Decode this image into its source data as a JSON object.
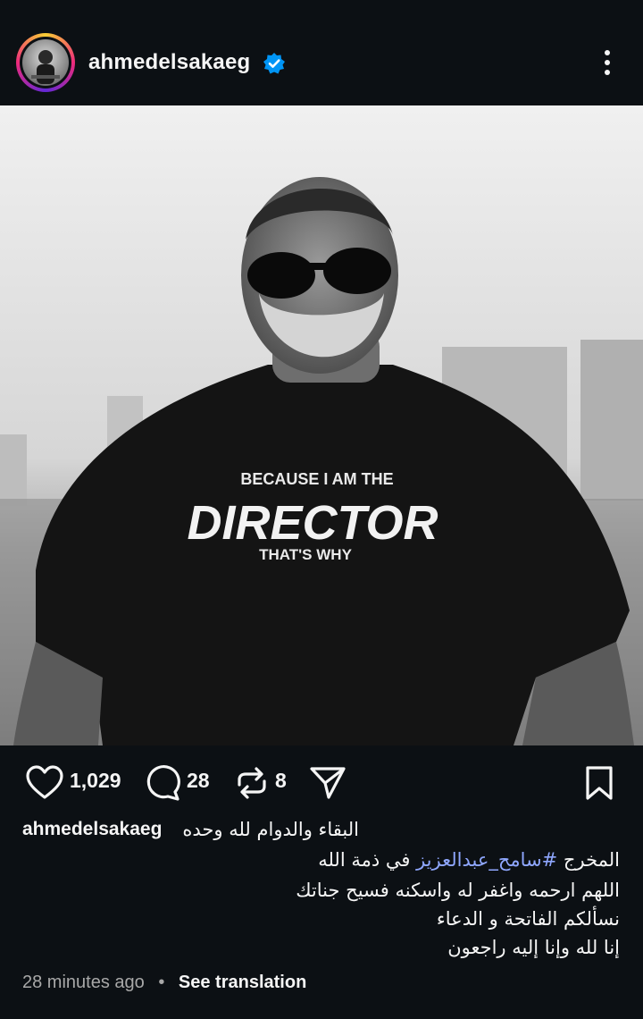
{
  "post": {
    "username": "ahmedelsakaeg",
    "verified": true,
    "icons": {
      "more": "more-vertical-icon",
      "verified": "verified-badge-icon"
    },
    "colors": {
      "background": "#0c1014",
      "verified": "#0095f6",
      "hashtag": "#8fa7ff",
      "muted": "#a8a8a8"
    }
  },
  "photo": {
    "shirt_line1": "BECAUSE I AM THE",
    "shirt_line2": "DIRECTOR",
    "shirt_line3": "THAT'S WHY"
  },
  "actions": {
    "likes": "1,029",
    "comments": "28",
    "reposts": "8",
    "icons": [
      "heart-icon",
      "comment-icon",
      "repost-icon",
      "share-icon",
      "bookmark-icon"
    ]
  },
  "caption": {
    "username": "ahmedelsakaeg",
    "line1": "البقاء والدوام لله وحده",
    "line2_prefix": "المخرج ",
    "line2_hashtag": "#سامح_عبدالعزيز",
    "line2_suffix": " في ذمة الله",
    "line3": "اللهم ارحمه واغفر له واسكنه فسيح جناتك",
    "line4": "نسألكم الفاتحة و الدعاء",
    "line5": "إنا لله وإنا إليه راجعون"
  },
  "meta": {
    "timestamp": "28 minutes ago",
    "separator": "•",
    "see_translation": "See translation"
  }
}
